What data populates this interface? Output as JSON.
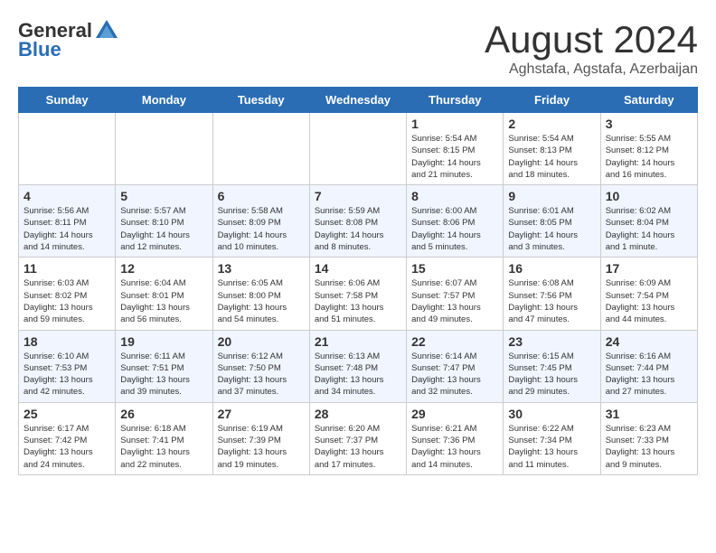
{
  "header": {
    "logo_general": "General",
    "logo_blue": "Blue",
    "month_title": "August 2024",
    "location": "Aghstafa, Agstafa, Azerbaijan"
  },
  "days_of_week": [
    "Sunday",
    "Monday",
    "Tuesday",
    "Wednesday",
    "Thursday",
    "Friday",
    "Saturday"
  ],
  "weeks": [
    [
      {
        "num": "",
        "info": ""
      },
      {
        "num": "",
        "info": ""
      },
      {
        "num": "",
        "info": ""
      },
      {
        "num": "",
        "info": ""
      },
      {
        "num": "1",
        "info": "Sunrise: 5:54 AM\nSunset: 8:15 PM\nDaylight: 14 hours\nand 21 minutes."
      },
      {
        "num": "2",
        "info": "Sunrise: 5:54 AM\nSunset: 8:13 PM\nDaylight: 14 hours\nand 18 minutes."
      },
      {
        "num": "3",
        "info": "Sunrise: 5:55 AM\nSunset: 8:12 PM\nDaylight: 14 hours\nand 16 minutes."
      }
    ],
    [
      {
        "num": "4",
        "info": "Sunrise: 5:56 AM\nSunset: 8:11 PM\nDaylight: 14 hours\nand 14 minutes."
      },
      {
        "num": "5",
        "info": "Sunrise: 5:57 AM\nSunset: 8:10 PM\nDaylight: 14 hours\nand 12 minutes."
      },
      {
        "num": "6",
        "info": "Sunrise: 5:58 AM\nSunset: 8:09 PM\nDaylight: 14 hours\nand 10 minutes."
      },
      {
        "num": "7",
        "info": "Sunrise: 5:59 AM\nSunset: 8:08 PM\nDaylight: 14 hours\nand 8 minutes."
      },
      {
        "num": "8",
        "info": "Sunrise: 6:00 AM\nSunset: 8:06 PM\nDaylight: 14 hours\nand 5 minutes."
      },
      {
        "num": "9",
        "info": "Sunrise: 6:01 AM\nSunset: 8:05 PM\nDaylight: 14 hours\nand 3 minutes."
      },
      {
        "num": "10",
        "info": "Sunrise: 6:02 AM\nSunset: 8:04 PM\nDaylight: 14 hours\nand 1 minute."
      }
    ],
    [
      {
        "num": "11",
        "info": "Sunrise: 6:03 AM\nSunset: 8:02 PM\nDaylight: 13 hours\nand 59 minutes."
      },
      {
        "num": "12",
        "info": "Sunrise: 6:04 AM\nSunset: 8:01 PM\nDaylight: 13 hours\nand 56 minutes."
      },
      {
        "num": "13",
        "info": "Sunrise: 6:05 AM\nSunset: 8:00 PM\nDaylight: 13 hours\nand 54 minutes."
      },
      {
        "num": "14",
        "info": "Sunrise: 6:06 AM\nSunset: 7:58 PM\nDaylight: 13 hours\nand 51 minutes."
      },
      {
        "num": "15",
        "info": "Sunrise: 6:07 AM\nSunset: 7:57 PM\nDaylight: 13 hours\nand 49 minutes."
      },
      {
        "num": "16",
        "info": "Sunrise: 6:08 AM\nSunset: 7:56 PM\nDaylight: 13 hours\nand 47 minutes."
      },
      {
        "num": "17",
        "info": "Sunrise: 6:09 AM\nSunset: 7:54 PM\nDaylight: 13 hours\nand 44 minutes."
      }
    ],
    [
      {
        "num": "18",
        "info": "Sunrise: 6:10 AM\nSunset: 7:53 PM\nDaylight: 13 hours\nand 42 minutes."
      },
      {
        "num": "19",
        "info": "Sunrise: 6:11 AM\nSunset: 7:51 PM\nDaylight: 13 hours\nand 39 minutes."
      },
      {
        "num": "20",
        "info": "Sunrise: 6:12 AM\nSunset: 7:50 PM\nDaylight: 13 hours\nand 37 minutes."
      },
      {
        "num": "21",
        "info": "Sunrise: 6:13 AM\nSunset: 7:48 PM\nDaylight: 13 hours\nand 34 minutes."
      },
      {
        "num": "22",
        "info": "Sunrise: 6:14 AM\nSunset: 7:47 PM\nDaylight: 13 hours\nand 32 minutes."
      },
      {
        "num": "23",
        "info": "Sunrise: 6:15 AM\nSunset: 7:45 PM\nDaylight: 13 hours\nand 29 minutes."
      },
      {
        "num": "24",
        "info": "Sunrise: 6:16 AM\nSunset: 7:44 PM\nDaylight: 13 hours\nand 27 minutes."
      }
    ],
    [
      {
        "num": "25",
        "info": "Sunrise: 6:17 AM\nSunset: 7:42 PM\nDaylight: 13 hours\nand 24 minutes."
      },
      {
        "num": "26",
        "info": "Sunrise: 6:18 AM\nSunset: 7:41 PM\nDaylight: 13 hours\nand 22 minutes."
      },
      {
        "num": "27",
        "info": "Sunrise: 6:19 AM\nSunset: 7:39 PM\nDaylight: 13 hours\nand 19 minutes."
      },
      {
        "num": "28",
        "info": "Sunrise: 6:20 AM\nSunset: 7:37 PM\nDaylight: 13 hours\nand 17 minutes."
      },
      {
        "num": "29",
        "info": "Sunrise: 6:21 AM\nSunset: 7:36 PM\nDaylight: 13 hours\nand 14 minutes."
      },
      {
        "num": "30",
        "info": "Sunrise: 6:22 AM\nSunset: 7:34 PM\nDaylight: 13 hours\nand 11 minutes."
      },
      {
        "num": "31",
        "info": "Sunrise: 6:23 AM\nSunset: 7:33 PM\nDaylight: 13 hours\nand 9 minutes."
      }
    ]
  ]
}
